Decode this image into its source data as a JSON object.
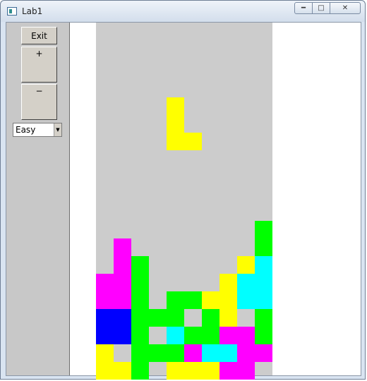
{
  "window": {
    "title": "Lab1"
  },
  "controls": {
    "exit_label": "Exit",
    "plus_label": "+",
    "minus_label": "−",
    "difficulty_selected": "Easy"
  },
  "board": {
    "cols": 10,
    "rows": 20,
    "background": "#cccccc",
    "palette": {
      "Y": "#ffff00",
      "M": "#ff00ff",
      "G": "#00ff00",
      "B": "#0000ff",
      "C": "#00ffff"
    },
    "active_piece": {
      "color": "#ffff00",
      "cells": [
        [
          4,
          5
        ],
        [
          4,
          6
        ],
        [
          4,
          7
        ],
        [
          5,
          7
        ]
      ]
    },
    "grid": [
      "..........",
      "..........",
      "..........",
      "..........",
      "..........",
      "..........",
      "..........",
      "..........",
      "..........",
      "..........",
      "..........",
      "..........",
      ".........G",
      ".M.......G",
      ".MG.....YC",
      "MMG....YCC",
      "MMG.GGYYCC",
      "BBGGG.GY.G",
      "BBG.CGGMMG",
      "Y.GGGMCCMM",
      "YYG.YYYMM."
    ]
  }
}
